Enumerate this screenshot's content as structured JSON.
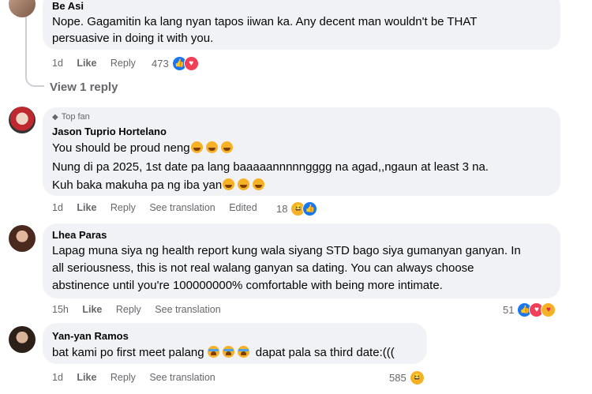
{
  "comments": [
    {
      "author": "Be Asi",
      "lines": [
        "Nope. Gagamitin ka lang nyan tapos iiwan ka. Any decent man wouldn't be THAT",
        "persuasive in doing it with you."
      ],
      "time": "1d",
      "like": "Like",
      "reply": "Reply",
      "reaction_count": "473",
      "reactions": [
        "like-icon",
        "heart-icon"
      ]
    },
    {
      "badge": "Top fan",
      "author": "Jason Tuprio Hortelano",
      "lines": [
        "You should be proud neng",
        "Nung di pa 2025, 1st date pa lang baaaaannnnngggg na agad,,ngaun at least 3 na.",
        "Kuh baka makuha pa ng iba yan"
      ],
      "time": "1d",
      "like": "Like",
      "reply": "Reply",
      "translation": "See translation",
      "edited": "Edited",
      "reaction_count": "18",
      "reactions": [
        "haha-icon",
        "like-icon"
      ]
    },
    {
      "author": "Lhea Paras",
      "lines": [
        "Lapag muna siya ng health report kung wala siyang STD bago siya gumanyan ganyan. In",
        "all seriousness, this is not real walang ganyan sa dating. You can always choose",
        "abstinence until you're 100000000% comfortable with being more intimate."
      ],
      "time": "15h",
      "like": "Like",
      "reply": "Reply",
      "translation": "See translation",
      "reaction_count": "51",
      "reactions": [
        "like-icon",
        "heart-icon",
        "care-icon"
      ]
    },
    {
      "author": "Yan-yan Ramos",
      "lines": [
        "bat kami po first meet palang",
        "dapat pala sa third date:((("
      ],
      "time": "1d",
      "like": "Like",
      "reply": "Reply",
      "translation": "See translation",
      "reaction_count": "585",
      "reactions": [
        "haha-icon"
      ]
    }
  ],
  "view_replies": "View 1 reply",
  "colors": {
    "bubble": "#f0f2f5",
    "meta": "#65676b",
    "like": "#1877f2",
    "heart": "#f33e58",
    "haha": "#f7b125"
  }
}
